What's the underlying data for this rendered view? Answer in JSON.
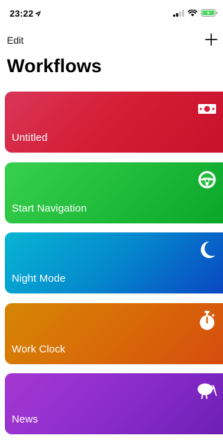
{
  "status_bar": {
    "time": "23:22",
    "icons": [
      "location-arrow-icon",
      "signal-icon",
      "wifi-icon",
      "battery-icon"
    ]
  },
  "nav": {
    "edit_label": "Edit",
    "add_icon": "plus-icon"
  },
  "title": "Workflows",
  "workflows": [
    {
      "label": "Untitled",
      "icon": "money-icon",
      "color": "#d51f36"
    },
    {
      "label": "Start Navigation",
      "icon": "steering-wheel-icon",
      "color": "#22be3c"
    },
    {
      "label": "Night Mode",
      "icon": "moon-icon",
      "color": "#0588cd"
    },
    {
      "label": "Work Clock",
      "icon": "stopwatch-icon",
      "color": "#d86b08"
    },
    {
      "label": "News",
      "icon": "kiwi-bird-icon",
      "color": "#8b2ccd"
    }
  ],
  "colors": {
    "battery": "#4cd964"
  }
}
